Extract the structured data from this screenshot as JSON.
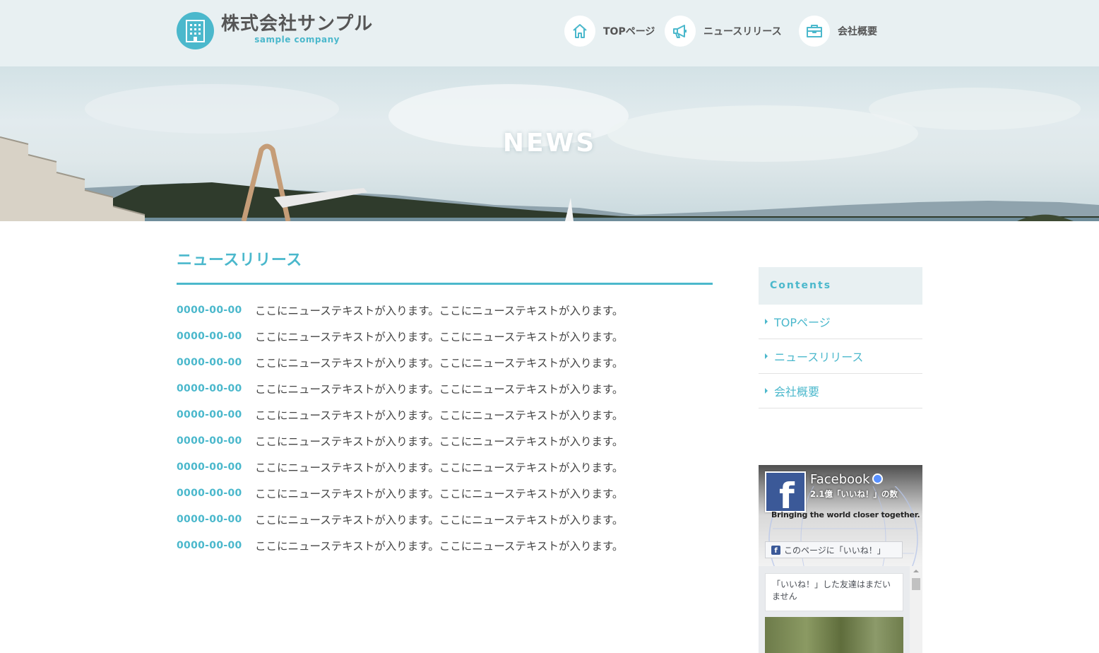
{
  "header": {
    "logo_ja": "株式会社サンプル",
    "logo_en": "sample company",
    "nav": [
      {
        "label": "TOPページ",
        "icon": "home-icon"
      },
      {
        "label": "ニュースリリース",
        "icon": "megaphone-icon"
      },
      {
        "label": "会社概要",
        "icon": "briefcase-icon"
      }
    ]
  },
  "hero": {
    "title": "NEWS"
  },
  "main": {
    "section_title": "ニュースリリース",
    "news": [
      {
        "date": "0000-00-00",
        "text": "ここにニューステキストが入ります。ここにニューステキストが入ります。"
      },
      {
        "date": "0000-00-00",
        "text": "ここにニューステキストが入ります。ここにニューステキストが入ります。"
      },
      {
        "date": "0000-00-00",
        "text": "ここにニューステキストが入ります。ここにニューステキストが入ります。"
      },
      {
        "date": "0000-00-00",
        "text": "ここにニューステキストが入ります。ここにニューステキストが入ります。"
      },
      {
        "date": "0000-00-00",
        "text": "ここにニューステキストが入ります。ここにニューステキストが入ります。"
      },
      {
        "date": "0000-00-00",
        "text": "ここにニューステキストが入ります。ここにニューステキストが入ります。"
      },
      {
        "date": "0000-00-00",
        "text": "ここにニューステキストが入ります。ここにニューステキストが入ります。"
      },
      {
        "date": "0000-00-00",
        "text": "ここにニューステキストが入ります。ここにニューステキストが入ります。"
      },
      {
        "date": "0000-00-00",
        "text": "ここにニューステキストが入ります。ここにニューステキストが入ります。"
      },
      {
        "date": "0000-00-00",
        "text": "ここにニューステキストが入ります。ここにニューステキストが入ります。"
      }
    ]
  },
  "sidebar": {
    "heading": "Contents",
    "items": [
      {
        "label": "TOPページ"
      },
      {
        "label": "ニュースリリース"
      },
      {
        "label": "会社概要"
      }
    ]
  },
  "facebook": {
    "page_name": "Facebook",
    "likes": "2.1億「いいね！」の数",
    "tagline": "Bringing the world closer together.",
    "like_button": "このページに「いいね！」",
    "friends_notice": "「いいね！」した友達はまだいません"
  },
  "colors": {
    "accent": "#4bb8cc",
    "header_bg": "#e8f0f2",
    "text": "#444444"
  }
}
